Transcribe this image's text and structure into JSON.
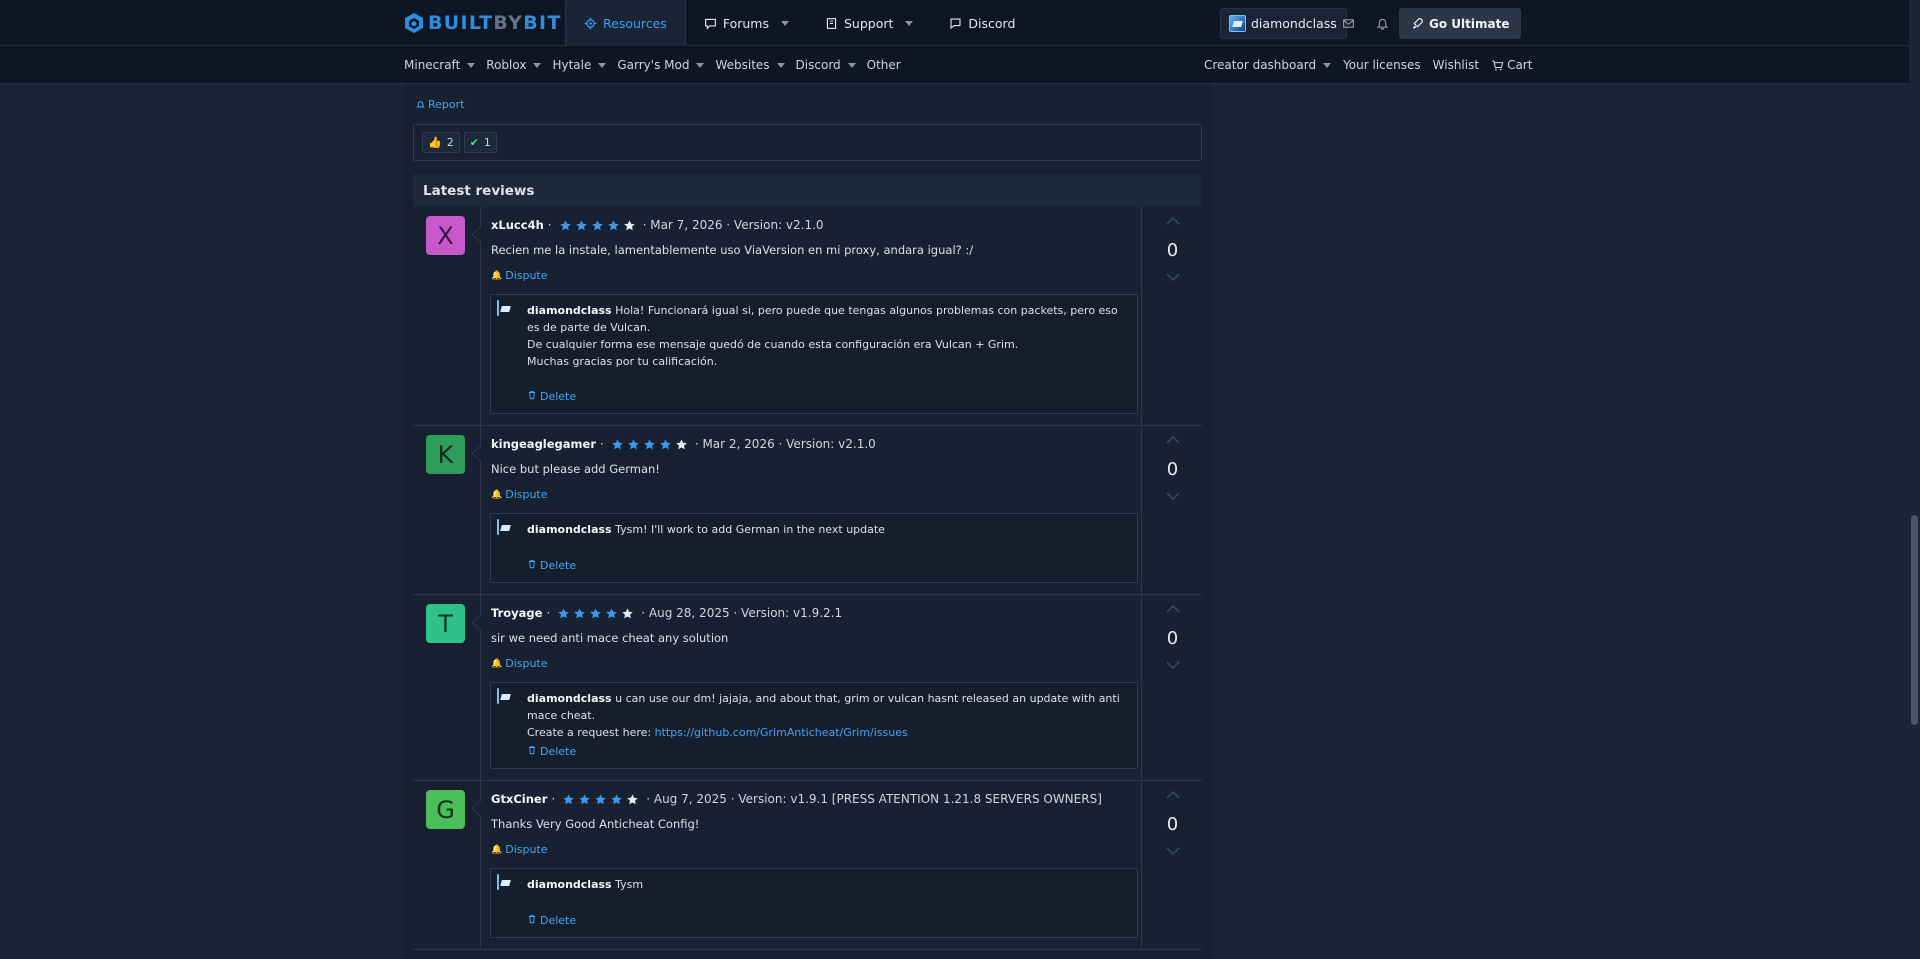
{
  "brand": {
    "part1": "BUILT",
    "part2": "BY",
    "part3": "BIT",
    "accent": "#2d8ee0"
  },
  "topnav": [
    {
      "label": "Resources",
      "icon": "gear-icon",
      "active": true
    },
    {
      "label": "Forums",
      "icon": "chat-icon",
      "dropdown": true
    },
    {
      "label": "Support",
      "icon": "book-icon",
      "dropdown": true
    },
    {
      "label": "Discord",
      "icon": "message-icon"
    }
  ],
  "user": {
    "name": "diamondclass"
  },
  "ultimate": {
    "label": "Go Ultimate"
  },
  "subnav": {
    "left": [
      {
        "label": "Minecraft",
        "dropdown": true
      },
      {
        "label": "Roblox",
        "dropdown": true
      },
      {
        "label": "Hytale",
        "dropdown": true
      },
      {
        "label": "Garry's Mod",
        "dropdown": true
      },
      {
        "label": "Websites",
        "dropdown": true
      },
      {
        "label": "Discord",
        "dropdown": true
      },
      {
        "label": "Other"
      }
    ],
    "right": [
      {
        "label": "Creator dashboard",
        "dropdown": true
      },
      {
        "label": "Your licenses"
      },
      {
        "label": "Wishlist"
      },
      {
        "label": "Cart",
        "icon": "cart-icon"
      }
    ]
  },
  "post": {
    "report_label": "Report",
    "reactions": [
      {
        "icon": "thumbs-up-icon",
        "count": "2"
      },
      {
        "icon": "checkmark-icon",
        "count": "1"
      }
    ]
  },
  "reviews_section": {
    "title": "Latest reviews",
    "dispute_label": "Dispute",
    "delete_label": "Delete",
    "items": [
      {
        "initial": "X",
        "avatar_color": "#c658c9",
        "avatar_text_color": "#3a1140",
        "author": "xLucc4h",
        "rating": 5,
        "date": "· Mar 7, 2026 · Version: v2.1.0",
        "text": "Recien me la instale, lamentablemente uso ViaVersion en mi proxy, andara igual? :/",
        "score": "0",
        "reply": {
          "author": "diamondclass",
          "lines": [
            "Hola! Funcionará igual si, pero puede que tengas algunos problemas con packets, pero eso es de parte de Vulcan.",
            "De cualquier forma ese mensaje quedó de cuando esta configuración era Vulcan + Grim.",
            "Muchas gracias por tu calificación."
          ],
          "link_prefix": "",
          "link": ""
        }
      },
      {
        "initial": "K",
        "avatar_color": "#2e9d5c",
        "avatar_text_color": "#0d2c1a",
        "author": "kingeaglegamer",
        "rating": 5,
        "date": "· Mar 2, 2026 · Version: v2.1.0",
        "text": "Nice but please add German!",
        "score": "0",
        "reply": {
          "author": "diamondclass",
          "lines": [
            "Tysm! I'll work to add German in the next update"
          ],
          "link_prefix": "",
          "link": ""
        }
      },
      {
        "initial": "T",
        "avatar_color": "#2fc18a",
        "avatar_text_color": "#0c3324",
        "author": "Troyage",
        "rating": 5,
        "date": "· Aug 28, 2025 · Version: v1.9.2.1",
        "text": "sir we need anti mace cheat any solution",
        "score": "0",
        "reply": {
          "author": "diamondclass",
          "lines": [
            "u can use our dm! jajaja, and about that, grim or vulcan hasnt released an update with anti mace cheat."
          ],
          "link_prefix": "Create a request here: ",
          "link": "https://github.com/GrimAnticheat/Grim/issues"
        }
      },
      {
        "initial": "G",
        "avatar_color": "#4cbf5b",
        "avatar_text_color": "#113419",
        "author": "GtxCiner",
        "rating": 5,
        "date": "· Aug 7, 2025 · Version: v1.9.1 [PRESS ATENTION 1.21.8 SERVERS OWNERS]",
        "text": "Thanks Very Good Anticheat Config!",
        "score": "0",
        "reply": {
          "author": "diamondclass",
          "lines": [
            "Tysm"
          ],
          "link_prefix": "",
          "link": ""
        }
      }
    ]
  }
}
